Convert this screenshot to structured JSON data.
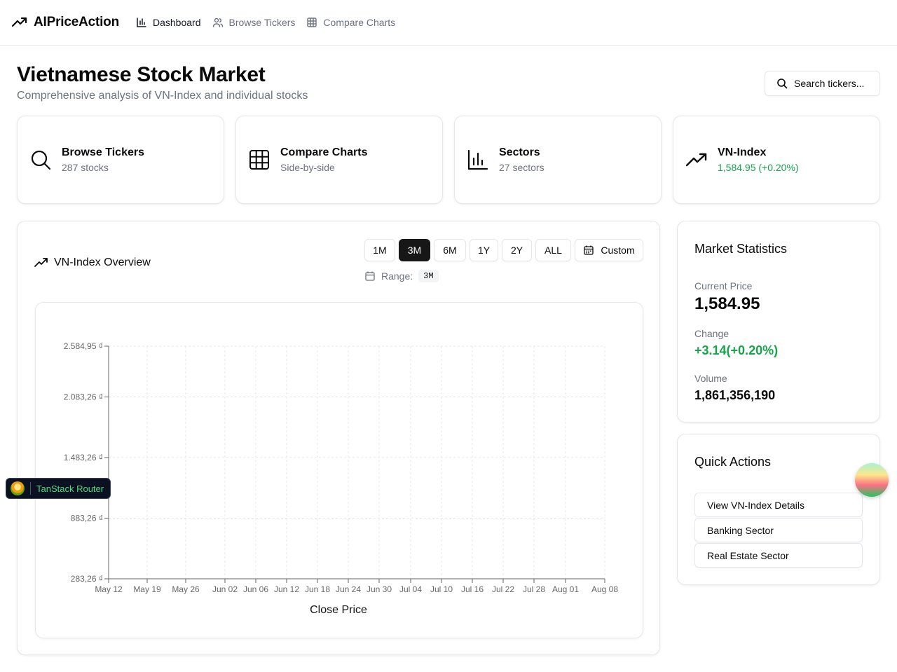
{
  "nav": {
    "brand": "AIPriceAction",
    "links": [
      {
        "label": "Dashboard",
        "icon": "bar-chart-icon",
        "active": true
      },
      {
        "label": "Browse Tickers",
        "icon": "users-icon",
        "active": false
      },
      {
        "label": "Compare Charts",
        "icon": "grid-icon",
        "active": false
      }
    ]
  },
  "header": {
    "title": "Vietnamese Stock Market",
    "subtitle": "Comprehensive analysis of VN-Index and individual stocks",
    "search_label": "Search tickers..."
  },
  "quick_cards": [
    {
      "title": "Browse Tickers",
      "subtitle": "287 stocks",
      "icon": "search-icon"
    },
    {
      "title": "Compare Charts",
      "subtitle": "Side-by-side",
      "icon": "grid-icon"
    },
    {
      "title": "Sectors",
      "subtitle": "27 sectors",
      "icon": "bar-chart-icon"
    },
    {
      "title": "VN-Index",
      "subtitle": "1,584.95 (+0.20%)",
      "icon": "trending-up-icon",
      "subtitle_color": "#16a34a"
    }
  ],
  "chart_panel": {
    "title": "VN-Index Overview",
    "ranges": [
      "1M",
      "3M",
      "6M",
      "1Y",
      "2Y",
      "ALL"
    ],
    "active_range": "3M",
    "custom_label": "Custom",
    "range_label": "Range:",
    "range_value": "3M"
  },
  "chart_data": {
    "type": "line",
    "xlabel": "",
    "ylabel": "",
    "legend": [
      "Close Price"
    ],
    "x_ticks": [
      "May 12",
      "May 19",
      "May 26",
      "Jun 02",
      "Jun 06",
      "Jun 12",
      "Jun 18",
      "Jun 24",
      "Jun 30",
      "Jul 04",
      "Jul 10",
      "Jul 16",
      "Jul 22",
      "Jul 28",
      "Aug 01",
      "Aug 08"
    ],
    "y_ticks": [
      "2.584,95 ₫",
      "2.083,26 ₫",
      "1.483,26 ₫",
      "883,26 ₫",
      "283,26 ₫"
    ],
    "y_tick_values": [
      2584.95,
      2083.26,
      1483.26,
      883.26,
      283.26
    ],
    "ylim": [
      283.26,
      2584.95
    ],
    "grid": true,
    "series": [
      {
        "name": "Close Price",
        "values": []
      }
    ]
  },
  "stats": {
    "title": "Market Statistics",
    "current_price_label": "Current Price",
    "current_price": "1,584.95",
    "change_label": "Change",
    "change": "+3.14(+0.20%)",
    "change_color": "#16a34a",
    "volume_label": "Volume",
    "volume": "1,861,356,190"
  },
  "quick_actions": {
    "title": "Quick Actions",
    "items": [
      "View VN-Index Details",
      "Banking Sector",
      "Real Estate Sector"
    ]
  },
  "devtools": {
    "router_label": "TanStack Router"
  }
}
